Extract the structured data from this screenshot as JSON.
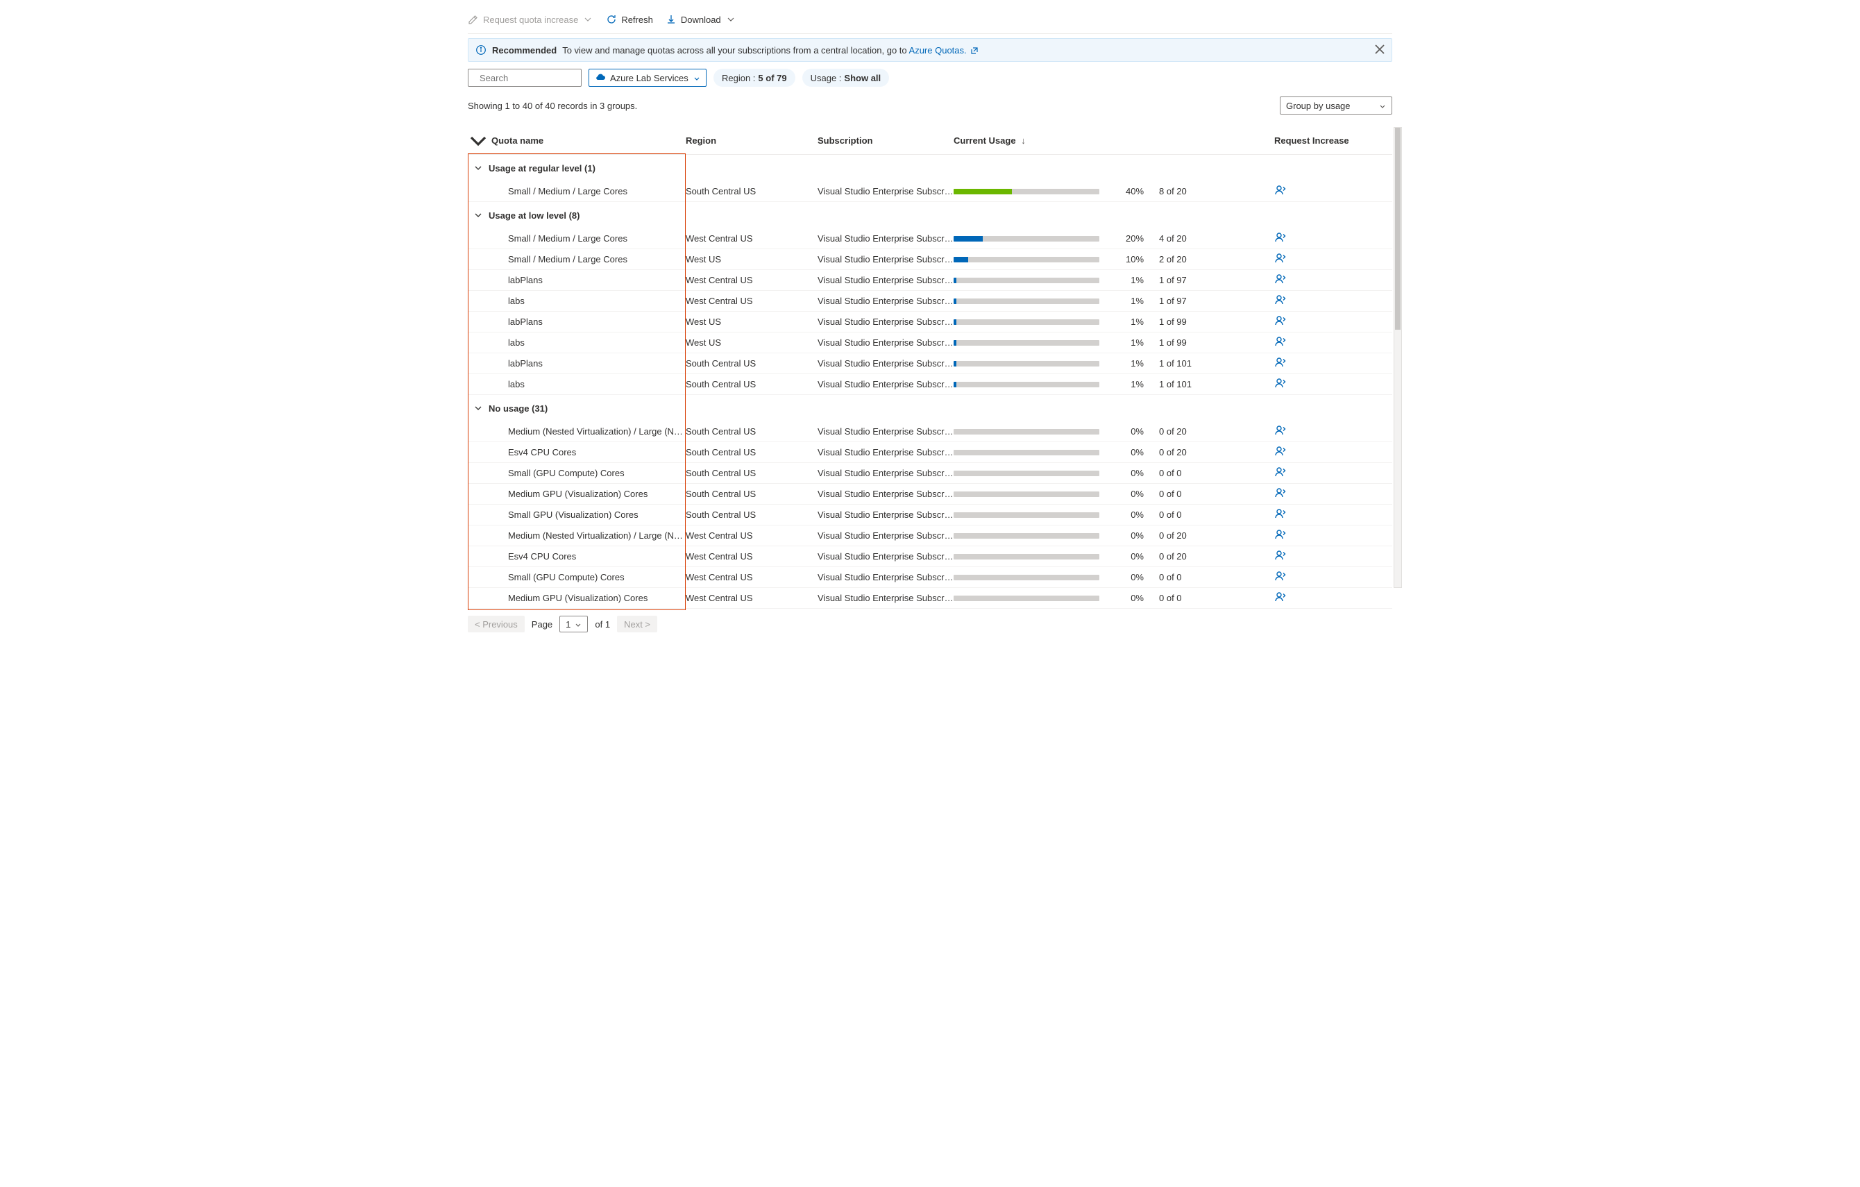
{
  "toolbar": {
    "request_increase": "Request quota increase",
    "refresh": "Refresh",
    "download": "Download"
  },
  "banner": {
    "strong": "Recommended",
    "text": "To view and manage quotas across all your subscriptions from a central location, go to ",
    "link_label": "Azure Quotas."
  },
  "filters": {
    "search_placeholder": "Search",
    "provider_label": "Azure Lab Services",
    "region_label": "Region : ",
    "region_value": "5 of 79",
    "usage_label": "Usage : ",
    "usage_value": "Show all"
  },
  "summary": {
    "showing": "Showing 1 to 40 of 40 records in 3 groups.",
    "group_by": "Group by usage"
  },
  "columns": {
    "name": "Quota name",
    "region": "Region",
    "subscription": "Subscription",
    "usage": "Current Usage",
    "request": "Request Increase"
  },
  "groups": [
    {
      "title": "Usage at regular level (1)",
      "rows": [
        {
          "name": "Small / Medium / Large Cores",
          "region": "South Central US",
          "sub": "Visual Studio Enterprise Subscri…",
          "pct": 40,
          "color": "green",
          "usage": "8 of 20"
        }
      ]
    },
    {
      "title": "Usage at low level (8)",
      "rows": [
        {
          "name": "Small / Medium / Large Cores",
          "region": "West Central US",
          "sub": "Visual Studio Enterprise Subscri…",
          "pct": 20,
          "color": "blue",
          "usage": "4 of 20"
        },
        {
          "name": "Small / Medium / Large Cores",
          "region": "West US",
          "sub": "Visual Studio Enterprise Subscri…",
          "pct": 10,
          "color": "blue",
          "usage": "2 of 20"
        },
        {
          "name": "labPlans",
          "region": "West Central US",
          "sub": "Visual Studio Enterprise Subscri…",
          "pct": 1,
          "color": "blue",
          "usage": "1 of 97"
        },
        {
          "name": "labs",
          "region": "West Central US",
          "sub": "Visual Studio Enterprise Subscri…",
          "pct": 1,
          "color": "blue",
          "usage": "1 of 97"
        },
        {
          "name": "labPlans",
          "region": "West US",
          "sub": "Visual Studio Enterprise Subscri…",
          "pct": 1,
          "color": "blue",
          "usage": "1 of 99"
        },
        {
          "name": "labs",
          "region": "West US",
          "sub": "Visual Studio Enterprise Subscri…",
          "pct": 1,
          "color": "blue",
          "usage": "1 of 99"
        },
        {
          "name": "labPlans",
          "region": "South Central US",
          "sub": "Visual Studio Enterprise Subscri…",
          "pct": 1,
          "color": "blue",
          "usage": "1 of 101"
        },
        {
          "name": "labs",
          "region": "South Central US",
          "sub": "Visual Studio Enterprise Subscri…",
          "pct": 1,
          "color": "blue",
          "usage": "1 of 101"
        }
      ]
    },
    {
      "title": "No usage (31)",
      "rows": [
        {
          "name": "Medium (Nested Virtualization) / Large (Nested …",
          "region": "South Central US",
          "sub": "Visual Studio Enterprise Subscri…",
          "pct": 0,
          "color": "gray",
          "usage": "0 of 20"
        },
        {
          "name": "Esv4 CPU Cores",
          "region": "South Central US",
          "sub": "Visual Studio Enterprise Subscri…",
          "pct": 0,
          "color": "gray",
          "usage": "0 of 20"
        },
        {
          "name": "Small (GPU Compute) Cores",
          "region": "South Central US",
          "sub": "Visual Studio Enterprise Subscri…",
          "pct": 0,
          "color": "gray",
          "usage": "0 of 0"
        },
        {
          "name": "Medium GPU (Visualization) Cores",
          "region": "South Central US",
          "sub": "Visual Studio Enterprise Subscri…",
          "pct": 0,
          "color": "gray",
          "usage": "0 of 0"
        },
        {
          "name": "Small GPU (Visualization) Cores",
          "region": "South Central US",
          "sub": "Visual Studio Enterprise Subscri…",
          "pct": 0,
          "color": "gray",
          "usage": "0 of 0"
        },
        {
          "name": "Medium (Nested Virtualization) / Large (Nested …",
          "region": "West Central US",
          "sub": "Visual Studio Enterprise Subscri…",
          "pct": 0,
          "color": "gray",
          "usage": "0 of 20"
        },
        {
          "name": "Esv4 CPU Cores",
          "region": "West Central US",
          "sub": "Visual Studio Enterprise Subscri…",
          "pct": 0,
          "color": "gray",
          "usage": "0 of 20"
        },
        {
          "name": "Small (GPU Compute) Cores",
          "region": "West Central US",
          "sub": "Visual Studio Enterprise Subscri…",
          "pct": 0,
          "color": "gray",
          "usage": "0 of 0"
        },
        {
          "name": "Medium GPU (Visualization) Cores",
          "region": "West Central US",
          "sub": "Visual Studio Enterprise Subscri…",
          "pct": 0,
          "color": "gray",
          "usage": "0 of 0"
        }
      ]
    }
  ],
  "pager": {
    "prev": "< Previous",
    "page_label": "Page",
    "page_num": "1",
    "of": "of 1",
    "next": "Next >"
  }
}
